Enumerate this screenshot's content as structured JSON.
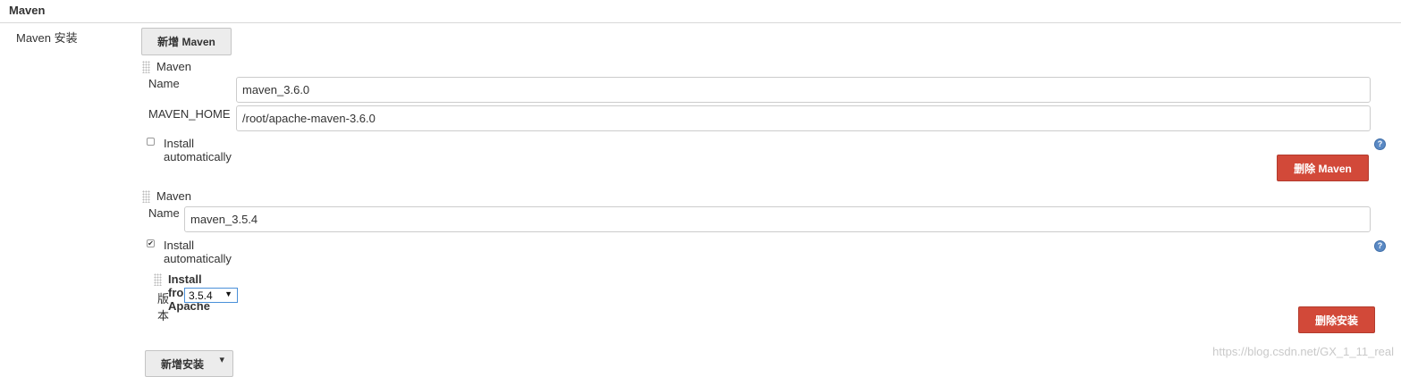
{
  "section": {
    "title": "Maven",
    "installs_label": "Maven 安装"
  },
  "buttons": {
    "add_maven": "新增 Maven",
    "delete_maven": "删除 Maven",
    "delete_install": "删除安装",
    "add_install": "新增安装",
    "add_install_caret": "▾"
  },
  "installs": [
    {
      "header": "Maven",
      "name_label": "Name",
      "name_value": "maven_3.6.0",
      "home_label": "MAVEN_HOME",
      "home_value": "/root/apache-maven-3.6.0",
      "auto_label": "Install automatically",
      "auto_checked": false,
      "check_mark": ""
    },
    {
      "header": "Maven",
      "name_label": "Name",
      "name_value": "maven_3.5.4",
      "auto_label": "Install automatically",
      "auto_checked": true,
      "check_mark": "✔",
      "installer": {
        "title": "Install from Apache",
        "version_label": "版本",
        "version_value": "3.5.4",
        "version_caret": "▼"
      }
    }
  ],
  "help_icon": "?",
  "watermark": "https://blog.csdn.net/GX_1_11_real",
  "colors": {
    "danger": "#d24939",
    "help": "#5a89c4",
    "rule": "#d8d8d8",
    "select_border": "#4a90d9"
  }
}
